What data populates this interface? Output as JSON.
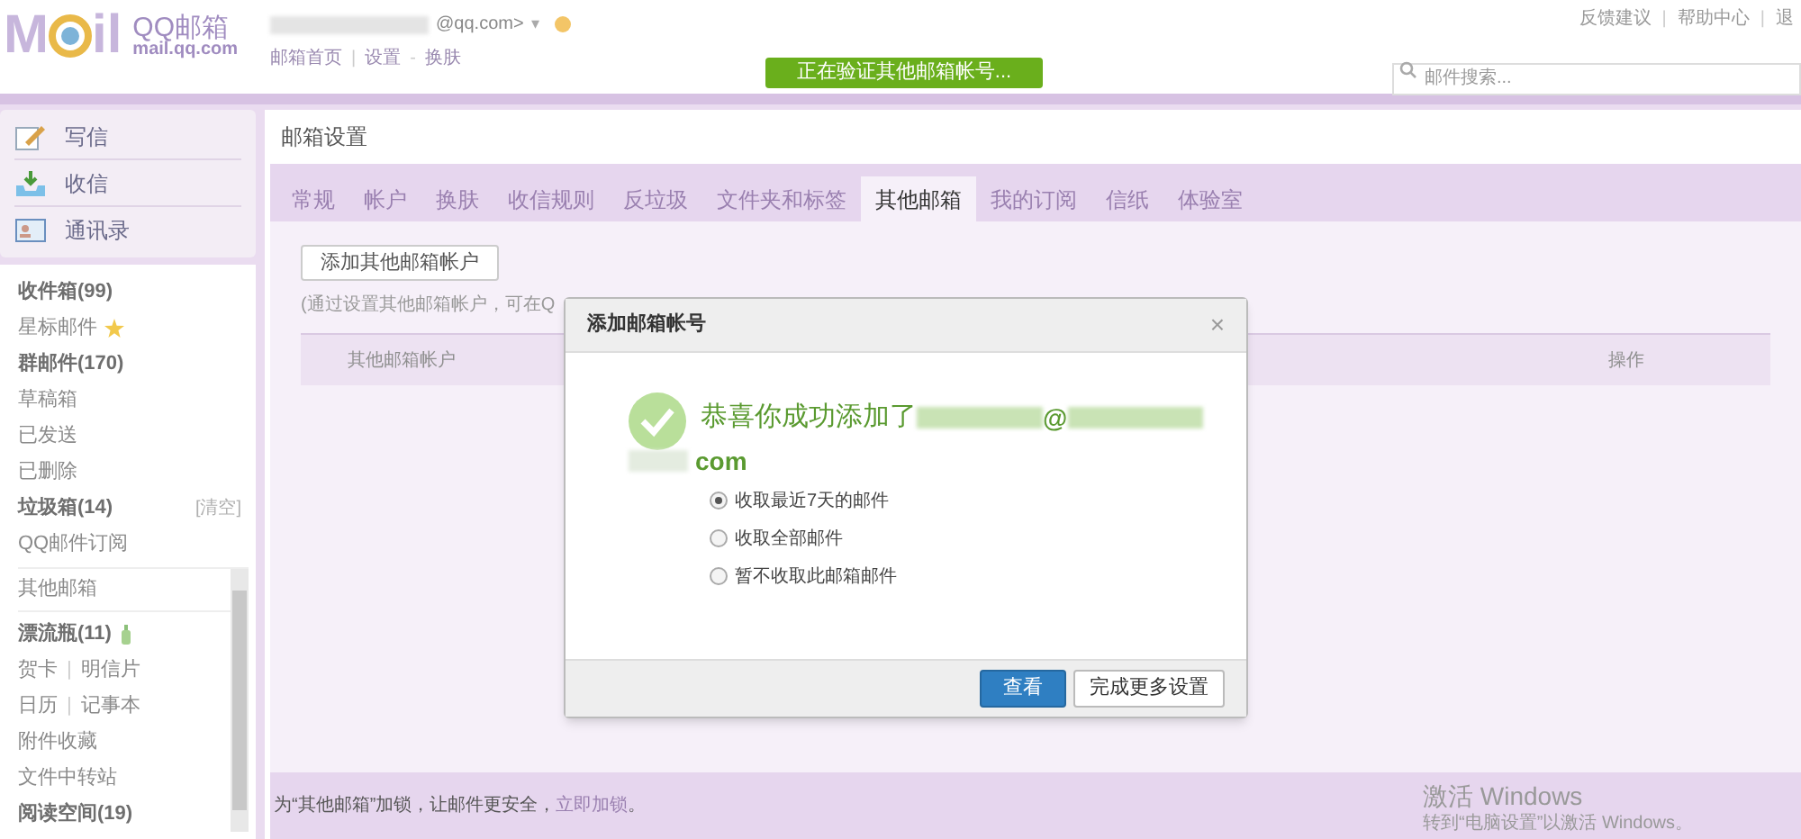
{
  "header": {
    "logo": [
      "M",
      "il"
    ],
    "brand": "QQ邮箱",
    "domain": "mail.qq.com",
    "account": "@qq.com>",
    "account_caret": "▾",
    "nav": [
      "邮箱首页",
      "|",
      "设置",
      "-",
      "换肤"
    ],
    "status": "正在验证其他邮箱帐号...",
    "top_links": [
      "反馈建议",
      "|",
      "帮助中心",
      "|",
      "退"
    ],
    "search": {
      "placeholder": "邮件搜索..."
    }
  },
  "sidebar": {
    "actions": [
      {
        "label": "写信"
      },
      {
        "label": "收信"
      },
      {
        "label": "通讯录"
      }
    ],
    "folders": [
      {
        "kind": "plain",
        "label": "收件箱(99)",
        "bold": true
      },
      {
        "kind": "star",
        "label": "星标邮件",
        "bold": false
      },
      {
        "kind": "plain",
        "label": "群邮件(170)",
        "bold": true
      },
      {
        "kind": "plain",
        "label": "草稿箱",
        "bold": false
      },
      {
        "kind": "plain",
        "label": "已发送",
        "bold": false
      },
      {
        "kind": "plain",
        "label": "已删除",
        "bold": false
      },
      {
        "kind": "clear",
        "label": "垃圾箱(14)",
        "bold": true,
        "extra": "[清空]"
      },
      {
        "kind": "plain",
        "label": "QQ邮件订阅",
        "bold": false
      }
    ],
    "other": "其他邮箱",
    "apps": [
      {
        "kind": "bottle",
        "labels": [
          "漂流瓶(11)"
        ],
        "bold": true
      },
      {
        "kind": "pair",
        "labels": [
          "贺卡",
          "|",
          "明信片"
        ],
        "bold": false
      },
      {
        "kind": "pair",
        "labels": [
          "日历",
          "|",
          "记事本"
        ],
        "bold": false
      },
      {
        "kind": "plain",
        "labels": [
          "附件收藏"
        ],
        "bold": false
      },
      {
        "kind": "plain",
        "labels": [
          "文件中转站"
        ],
        "bold": false
      },
      {
        "kind": "plain",
        "labels": [
          "阅读空间(19)"
        ],
        "bold": true
      }
    ]
  },
  "main": {
    "title": "邮箱设置",
    "tabs": [
      {
        "label": "常规",
        "selected": false
      },
      {
        "label": "帐户",
        "selected": false
      },
      {
        "label": "换肤",
        "selected": false
      },
      {
        "label": "收信规则",
        "selected": false
      },
      {
        "label": "反垃圾",
        "selected": false
      },
      {
        "label": "文件夹和标签",
        "selected": false
      },
      {
        "label": "其他邮箱",
        "selected": true
      },
      {
        "label": "我的订阅",
        "selected": false
      },
      {
        "label": "信纸",
        "selected": false
      },
      {
        "label": "体验室",
        "selected": false
      }
    ],
    "add_button": "添加其他邮箱帐户",
    "hint": "(通过设置其他邮箱帐户，可在Q",
    "columns": [
      "其他邮箱帐户",
      "操作"
    ],
    "footer": {
      "text": "为“其他邮箱”加锁，让邮件更安全，",
      "link": "立即加锁",
      "end": "。"
    },
    "activation": {
      "title": "激活 Windows",
      "text": "转到“电脑设置”以激活 Windows。"
    }
  },
  "dialog": {
    "title": "添加邮箱帐号",
    "close": "×",
    "message": "恭喜你成功添加了",
    "at": "@",
    "domain_end": "com",
    "options": [
      {
        "label": "收取最近7天的邮件",
        "selected": true
      },
      {
        "label": "收取全部邮件",
        "selected": false
      },
      {
        "label": "暂不收取此邮箱邮件",
        "selected": false
      }
    ],
    "buttons": [
      {
        "label": "查看",
        "kind": "primary"
      },
      {
        "label": "完成更多设置",
        "kind": "secondary"
      }
    ]
  }
}
